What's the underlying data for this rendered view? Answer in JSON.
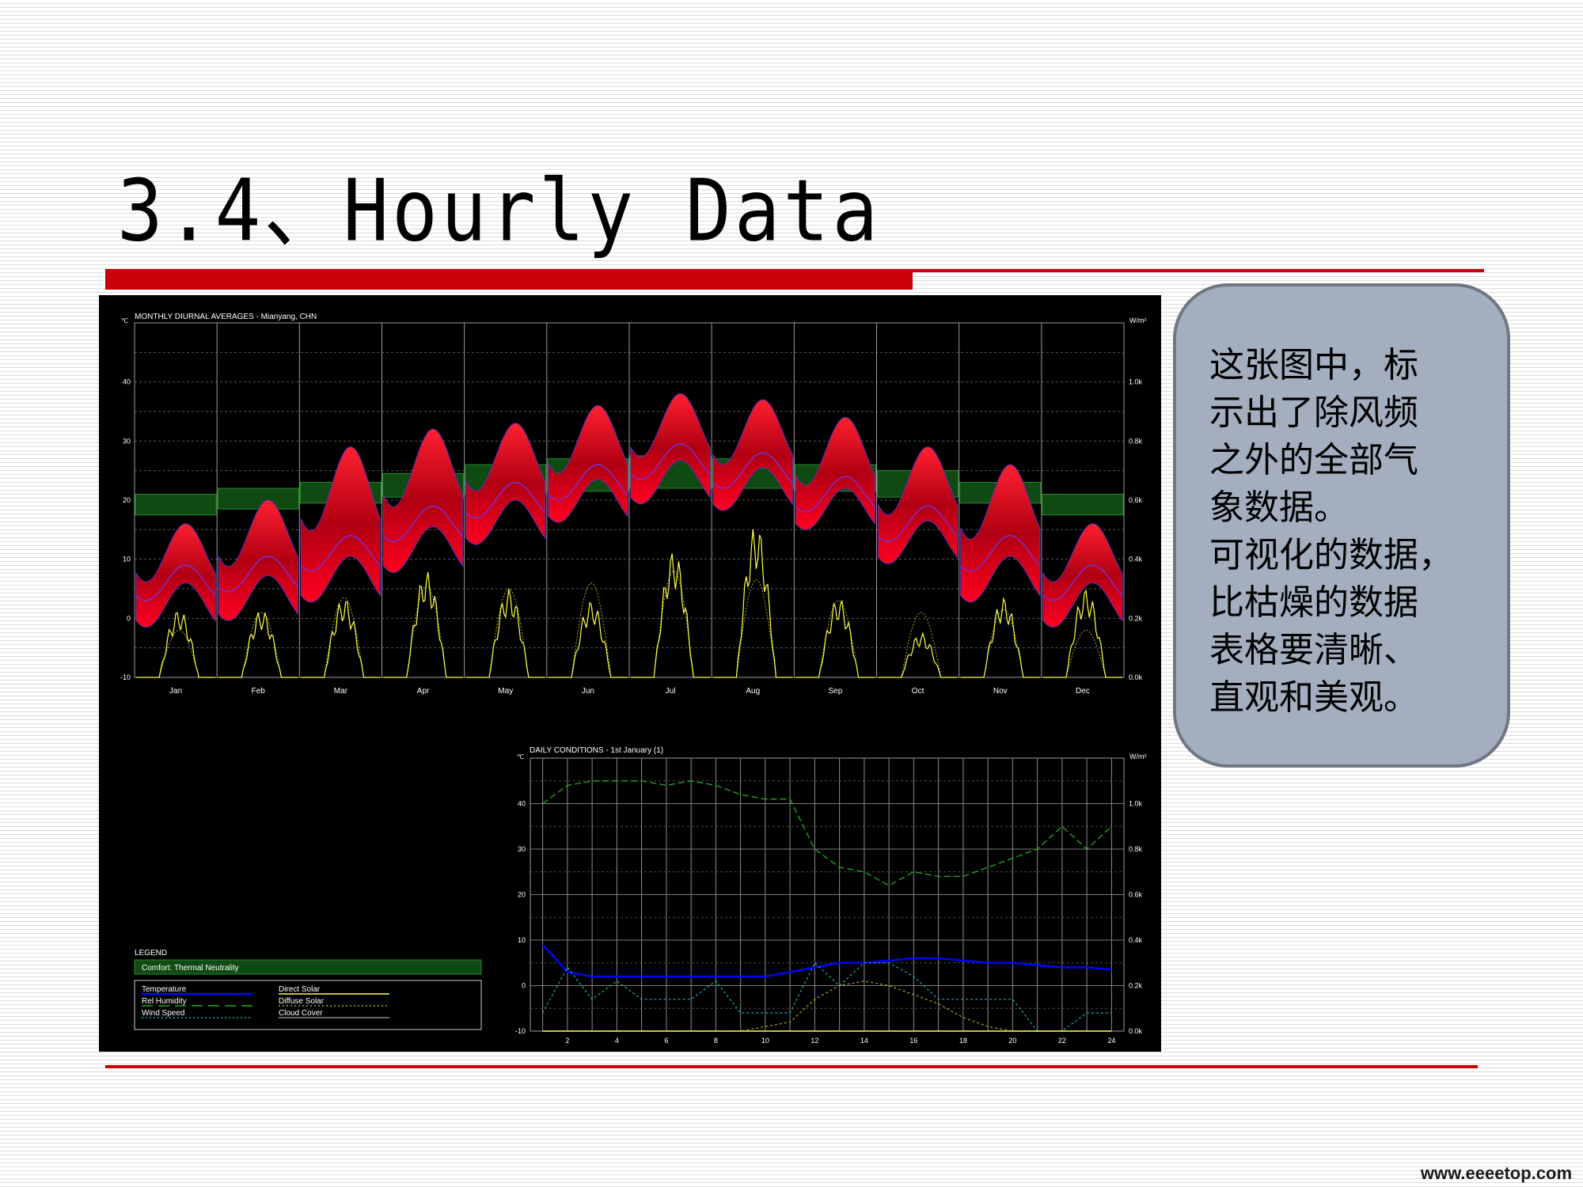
{
  "slide": {
    "title": "3.4、Hourly Data",
    "watermark": "www.eeeetop.com",
    "callout_lines": [
      "这张图中，标",
      "示出了除风频",
      "之外的全部气",
      "象数据。",
      "可视化的数据，",
      "比枯燥的数据",
      "表格要清晰、",
      "直观和美观。"
    ]
  },
  "colors": {
    "accent_red": "#c8000a",
    "temperature": "#0000ff",
    "rel_humidity": "#22aa22",
    "wind_speed": "#1ab0b0",
    "direct_solar": "#ffff44",
    "diffuse_solar": "#aaaa22",
    "cloud_cover": "#888888",
    "comfort_band": "#0f4a12",
    "temp_band": "#ff0022"
  },
  "chart_data": [
    {
      "type": "area",
      "title": "MONTHLY DIURNAL AVERAGES - Mianyang, CHN",
      "left_unit": "℃",
      "right_unit": "W/m²",
      "y_ticks": [
        -10,
        0,
        10,
        20,
        30,
        40
      ],
      "ylim": [
        -10,
        50
      ],
      "y2_ticks": [
        "0.0k",
        "0.2k",
        "0.4k",
        "0.6k",
        "0.8k",
        "1.0k"
      ],
      "y2lim": [
        0,
        1200
      ],
      "grid": true,
      "categories": [
        "Jan",
        "Feb",
        "Mar",
        "Apr",
        "May",
        "Jun",
        "Jul",
        "Aug",
        "Sep",
        "Oct",
        "Nov",
        "Dec"
      ],
      "series": [
        {
          "name": "Temperature",
          "role": "mean",
          "values": [
            6,
            7.5,
            11,
            16,
            20,
            23,
            26.5,
            25,
            21,
            16,
            11,
            6
          ]
        },
        {
          "name": "Temperature",
          "role": "range_min",
          "values": [
            0,
            1,
            4,
            9,
            14,
            18,
            21,
            20,
            17,
            11,
            4,
            0
          ]
        },
        {
          "name": "Temperature",
          "role": "range_max",
          "values": [
            13,
            17,
            26,
            29,
            30,
            33,
            35,
            34,
            31,
            26,
            23,
            13
          ]
        },
        {
          "name": "Comfort: Thermal Neutrality",
          "role": "band_low",
          "values": [
            17.5,
            18.5,
            19.5,
            20.5,
            21,
            21.5,
            22,
            22,
            21.5,
            20.5,
            19.5,
            17.5
          ]
        },
        {
          "name": "Comfort: Thermal Neutrality",
          "role": "band_high",
          "values": [
            21,
            22,
            23,
            24.5,
            26,
            27,
            27.5,
            27,
            26,
            25,
            23,
            21
          ]
        },
        {
          "name": "Direct Solar",
          "unit": "W/m²",
          "values": [
            230,
            230,
            270,
            360,
            300,
            260,
            430,
            520,
            270,
            150,
            270,
            300
          ]
        },
        {
          "name": "Diffuse Solar",
          "unit": "W/m²",
          "values": [
            160,
            220,
            270,
            310,
            300,
            320,
            360,
            330,
            260,
            220,
            230,
            160
          ]
        }
      ]
    },
    {
      "type": "line",
      "title": "DAILY CONDITIONS - 1st January (1)",
      "left_unit": "℃",
      "right_unit": "W/m²",
      "x": [
        1,
        2,
        3,
        4,
        5,
        6,
        7,
        8,
        9,
        10,
        11,
        12,
        13,
        14,
        15,
        16,
        17,
        18,
        19,
        20,
        21,
        22,
        23,
        24
      ],
      "x_ticks": [
        2,
        4,
        6,
        8,
        10,
        12,
        14,
        16,
        18,
        20,
        22,
        24
      ],
      "y_ticks": [
        -10,
        0,
        10,
        20,
        30,
        40
      ],
      "ylim": [
        -10,
        50
      ],
      "y2_ticks": [
        "0.0k",
        "0.2k",
        "0.4k",
        "0.6k",
        "0.8k",
        "1.0k"
      ],
      "y2lim": [
        0,
        1200
      ],
      "grid": true,
      "series": [
        {
          "name": "Temperature",
          "values": [
            9,
            3,
            2,
            2,
            2,
            2,
            2,
            2,
            2,
            2,
            3,
            4,
            5,
            5,
            5.5,
            6,
            6,
            5.5,
            5,
            5,
            4.5,
            4,
            4,
            3.5
          ]
        },
        {
          "name": "Rel Humidity",
          "values": [
            40,
            44,
            45,
            45,
            45,
            44,
            45,
            44,
            42,
            41,
            41,
            30,
            26,
            25,
            22,
            25,
            24,
            24,
            26,
            28,
            30,
            35,
            30,
            35
          ]
        },
        {
          "name": "Wind Speed",
          "values": [
            -6,
            4,
            -3,
            1,
            -3,
            -3,
            -3,
            1,
            -6,
            -6,
            -6,
            5,
            0,
            5,
            5,
            2,
            -3,
            -3,
            -3,
            -3,
            -10,
            -10,
            -6,
            -6
          ]
        },
        {
          "name": "Diffuse Solar",
          "values": [
            -10,
            -10,
            -10,
            -10,
            -10,
            -10,
            -10,
            -10,
            -10,
            -9,
            -8,
            -3,
            0,
            1,
            0,
            -2,
            -4,
            -7,
            -9,
            -10,
            -10,
            -10,
            -10,
            -10
          ]
        },
        {
          "name": "Direct Solar",
          "values": [
            -10,
            -10,
            -10,
            -10,
            -10,
            -10,
            -10,
            -10,
            -10,
            -10,
            -10,
            -10,
            -10,
            -10,
            -10,
            -10,
            -10,
            -10,
            -10,
            -10,
            -10,
            -10,
            -10,
            -10
          ]
        }
      ]
    }
  ],
  "legend": {
    "title": "LEGEND",
    "comfort": "Comfort: Thermal Neutrality",
    "items": [
      {
        "label": "Temperature",
        "color": "#0000ff",
        "style": "solid"
      },
      {
        "label": "Direct Solar",
        "color": "#ffff44",
        "style": "solid"
      },
      {
        "label": "Rel Humidity",
        "color": "#22aa22",
        "style": "dash"
      },
      {
        "label": "Diffuse Solar",
        "color": "#aaaa22",
        "style": "dot"
      },
      {
        "label": "Wind Speed",
        "color": "#1ab0b0",
        "style": "dot"
      },
      {
        "label": "Cloud Cover",
        "color": "#888888",
        "style": "solid"
      }
    ]
  }
}
